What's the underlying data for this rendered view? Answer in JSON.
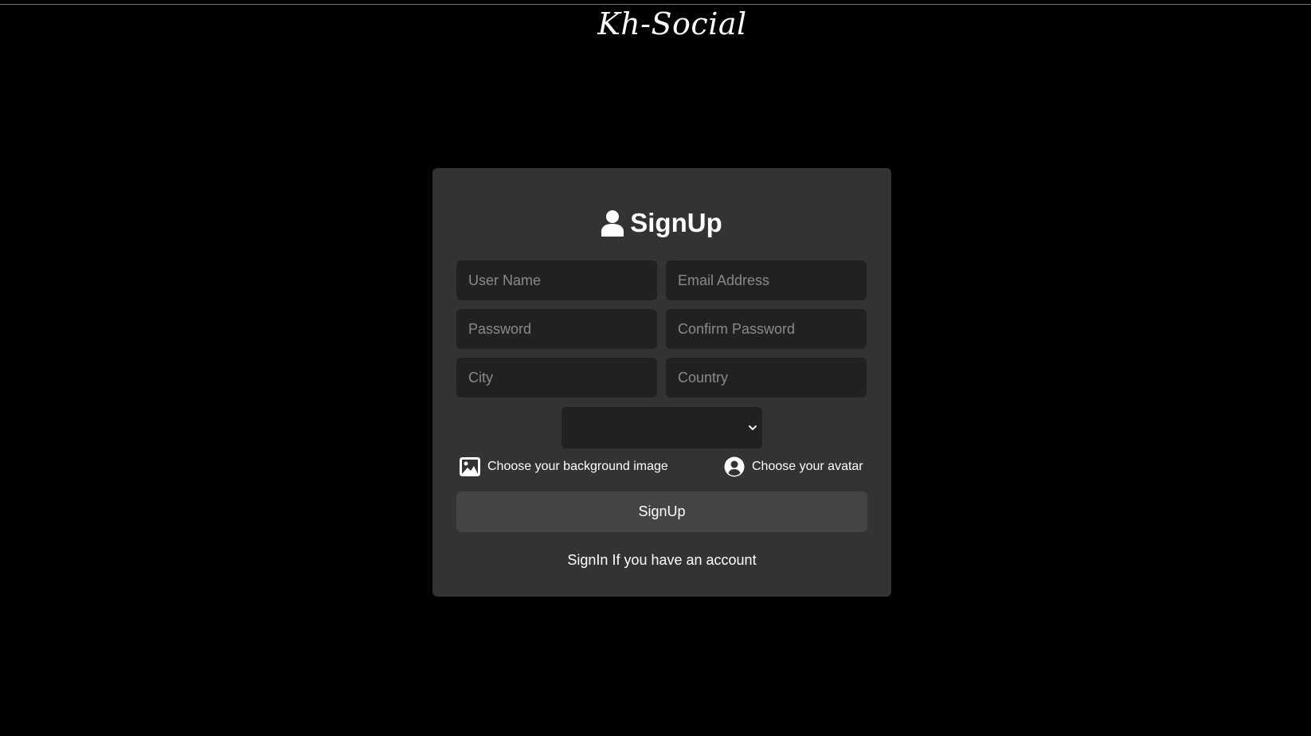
{
  "header": {
    "brand": "Kh-Social"
  },
  "form": {
    "title": "SignUp",
    "title_icon": "user-icon",
    "fields": {
      "username": {
        "placeholder": "User Name",
        "value": ""
      },
      "email": {
        "placeholder": "Email Address",
        "value": ""
      },
      "password": {
        "placeholder": "Password",
        "value": ""
      },
      "confirm_password": {
        "placeholder": "Confirm Password",
        "value": ""
      },
      "city": {
        "placeholder": "City",
        "value": ""
      },
      "country": {
        "placeholder": "Country",
        "value": ""
      }
    },
    "select": {
      "selected": ""
    },
    "background_upload": {
      "label": "Choose your background image",
      "icon": "image-icon"
    },
    "avatar_upload": {
      "label": "Choose your avatar",
      "icon": "user-circle-icon"
    },
    "submit_label": "SignUp",
    "signin_link": "SignIn If you have an account"
  },
  "colors": {
    "page_background": "#000000",
    "card_background": "#333333",
    "field_background": "#212121",
    "button_background": "#444444",
    "placeholder_text": "#8a8a8a",
    "text": "#ffffff"
  }
}
